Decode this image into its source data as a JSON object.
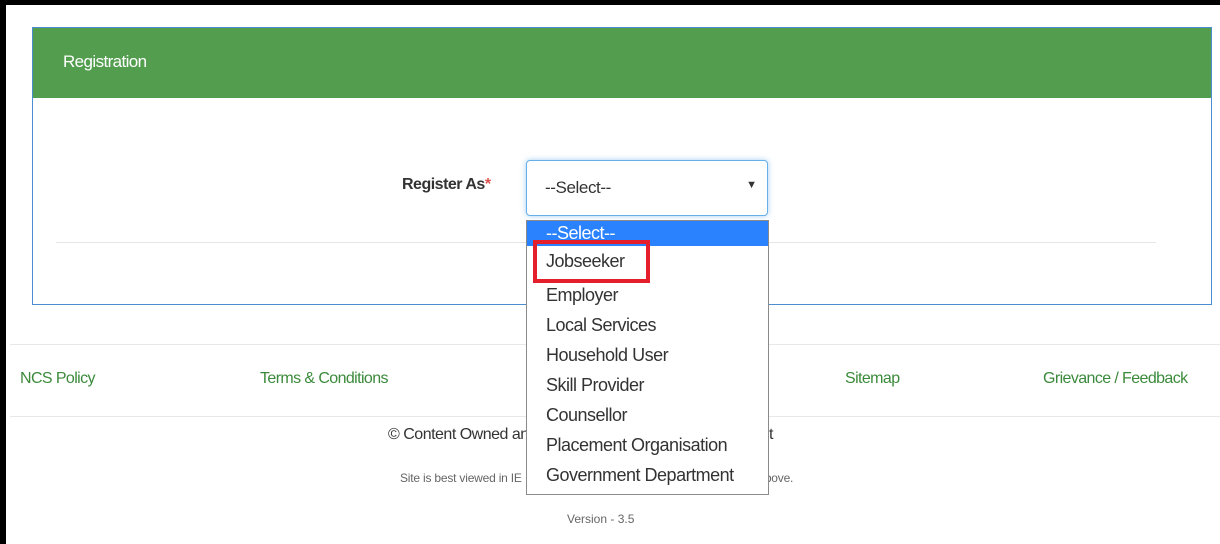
{
  "panel": {
    "title": "Registration"
  },
  "form": {
    "register_as_label": "Register As",
    "required_mark": "*",
    "select_value": "--Select--",
    "options": [
      "--Select--",
      "Jobseeker",
      "Employer",
      "Local Services",
      "Household User",
      "Skill Provider",
      "Counsellor",
      "Placement Organisation",
      "Government Department"
    ],
    "highlighted_option": "Jobseeker"
  },
  "footer": {
    "links": [
      "NCS Policy",
      "Terms & Conditions",
      "Sitemap",
      "Grievance / Feedback"
    ],
    "copyright_visible": "© Content Owned and",
    "copyright_tail": "ployment",
    "browser_note_visible": "Site is best viewed in IE",
    "browser_note_tail": "d above.",
    "version": "Version - 3.5"
  },
  "colors": {
    "header_green": "#529e4e",
    "link_green": "#3b8a3b",
    "selected_blue": "#2a82ff",
    "highlight_red": "#e41e2a"
  },
  "icons": {
    "select_arrow": "caret-down-icon"
  }
}
